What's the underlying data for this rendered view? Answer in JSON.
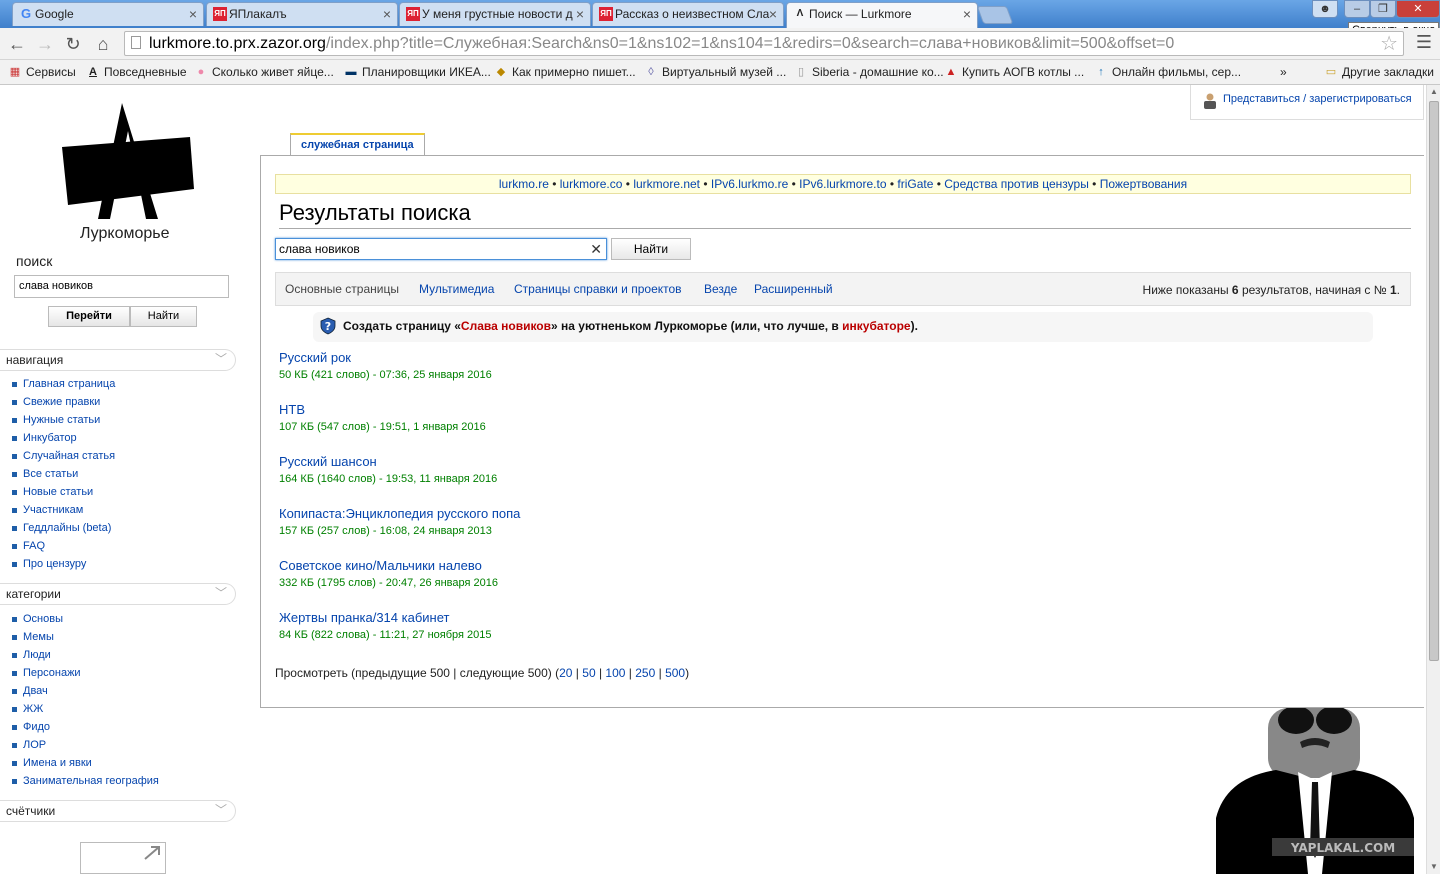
{
  "browser": {
    "tabs": [
      {
        "title": "Google",
        "icon": "google-icon"
      },
      {
        "title": "ЯПлакалъ",
        "icon": "yaplakal-icon"
      },
      {
        "title": "У меня грустные новости д",
        "icon": "yaplakal-icon"
      },
      {
        "title": "Рассказ о неизвестном Сла",
        "icon": "yaplakal-icon"
      },
      {
        "title": "Поиск — Lurkmore",
        "icon": "lurkmore-icon"
      }
    ],
    "tooltip": "Свернуть в окно",
    "url_host": "lurkmore.to.prx.zazor.org",
    "url_path": "/index.php?title=Служебная:Search&ns0=1&ns102=1&ns104=1&redirs=0&search=слава+новиков&limit=500&offset=0",
    "bookmarks": [
      "Сервисы",
      "Повседневные",
      "Сколько живет яйце...",
      "Планировщики ИКЕА...",
      "Как примерно пишет...",
      "Виртуальный музей ...",
      "Siberia - домашние ко...",
      "Купить АОГВ котлы ...",
      "Онлайн фильмы, сер...",
      "»",
      "Другие закладки"
    ]
  },
  "personal": {
    "login_link": "Представиться / зарегистрироваться"
  },
  "sidebar": {
    "site_name": "Луркоморье",
    "search_label": "поиск",
    "search_value": "слава новиков",
    "go_button": "Перейти",
    "find_button": "Найти",
    "navigation_title": "навигация",
    "navigation": [
      "Главная страница",
      "Свежие правки",
      "Нужные статьи",
      "Инкубатор",
      "Случайная статья",
      "Все статьи",
      "Новые статьи",
      "Участникам",
      "Геддлайны (beta)",
      "FAQ",
      "Про цензуру"
    ],
    "categories_title": "категории",
    "categories": [
      "Основы",
      "Мемы",
      "Люди",
      "Персонажи",
      "Двач",
      "ЖЖ",
      "Фидо",
      "ЛОР",
      "Имена и явки",
      "Занимательная география"
    ],
    "counters_title": "счётчики"
  },
  "content": {
    "tab_label": "служебная страница",
    "notice": [
      "lurkmo.re",
      "lurkmore.co",
      "lurkmore.net",
      "IPv6.lurkmo.re",
      "IPv6.lurkmore.to",
      "friGate",
      "Средства против цензуры",
      "Пожертвования"
    ],
    "heading": "Результаты поиска",
    "search_value": "слава новиков",
    "search_button": "Найти",
    "filters": [
      "Основные страницы",
      "Мультимедиа",
      "Страницы справки и проектов",
      "Везде",
      "Расширенный"
    ],
    "info_prefix": "Ниже показаны ",
    "info_count": "6",
    "info_middle": " результатов, начиная с № ",
    "info_start": "1",
    "info_suffix": ".",
    "create_prefix": "Создать страницу «",
    "create_title": "Слава новиков",
    "create_middle": "» на уютненьком Луркоморье (или, что лучше, в ",
    "create_link": "инкубаторе",
    "create_suffix": ").",
    "results": [
      {
        "title": "Русский рок",
        "meta": "50 КБ (421 слово) - 07:36, 25 января 2016"
      },
      {
        "title": "НТВ",
        "meta": "107 КБ (547 слов) - 19:51, 1 января 2016"
      },
      {
        "title": "Русский шансон",
        "meta": "164 КБ (1640 слов) - 19:53, 11 января 2016"
      },
      {
        "title": "Копипаста:Энциклопедия русского попа",
        "meta": "157 КБ (257 слов) - 16:08, 24 января 2013"
      },
      {
        "title": "Советское кино/Мальчики налево",
        "meta": "332 КБ (1795 слов) - 20:47, 26 января 2016"
      },
      {
        "title": "Жертвы пранка/314 кабинет",
        "meta": "84 КБ (822 слова) - 11:21, 27 ноября 2015"
      }
    ],
    "pager_prefix": "Просмотреть (предыдущие 500 | следующие 500) (",
    "pager_links": [
      "20",
      "50",
      "100",
      "250",
      "500"
    ],
    "pager_suffix": ")"
  },
  "watermark": "YAPLAKAL.COM"
}
